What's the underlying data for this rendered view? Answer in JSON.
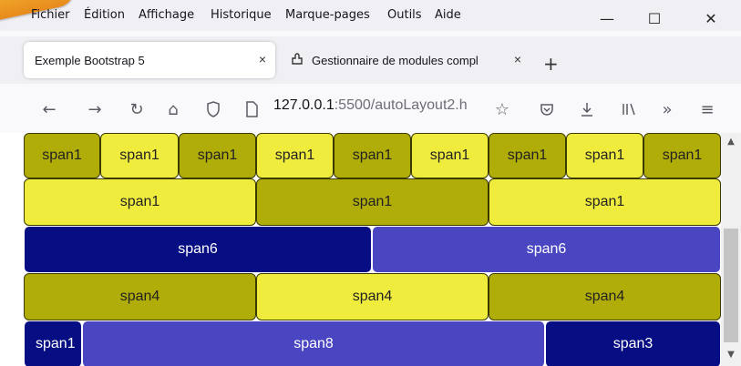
{
  "menu": {
    "items": [
      {
        "label": "Fichier"
      },
      {
        "label": "Édition"
      },
      {
        "label": "Affichage"
      },
      {
        "label": "Historique"
      },
      {
        "label": "Marque-pages"
      },
      {
        "label": "Outils"
      },
      {
        "label": "Aide"
      }
    ]
  },
  "window": {
    "minimize": "—",
    "maximize": "☐",
    "close": "✕"
  },
  "tabs": [
    {
      "title": "Exemple Bootstrap 5",
      "close": "×"
    },
    {
      "title": "Gestionnaire de modules compl",
      "close": "×"
    }
  ],
  "new_tab_label": "+",
  "nav": {
    "url_host": "127.0.0.1",
    "url_path": ":5500/autoLayout2.h",
    "icons": [
      "back-icon",
      "forward-icon",
      "reload-icon",
      "home-icon",
      "shield-icon",
      "page-icon",
      "bookmark-star-icon",
      "pocket-icon",
      "download-icon",
      "library-icon",
      "overflow-icon",
      "menu-icon"
    ]
  },
  "grid": {
    "row1": [
      "span1",
      "span1",
      "span1",
      "span1",
      "span1",
      "span1",
      "span1",
      "span1",
      "span1"
    ],
    "row2": [
      "span1",
      "span1",
      "span1"
    ],
    "row3": [
      "span6",
      "span6"
    ],
    "row4": [
      "span4",
      "span4",
      "span4"
    ],
    "row5": [
      "span1",
      "span8",
      "span3"
    ]
  },
  "colors": {
    "olive": "#b1ad08",
    "yellow": "#f0ec3e",
    "navy": "#070d82",
    "blue": "#4a46c2"
  }
}
